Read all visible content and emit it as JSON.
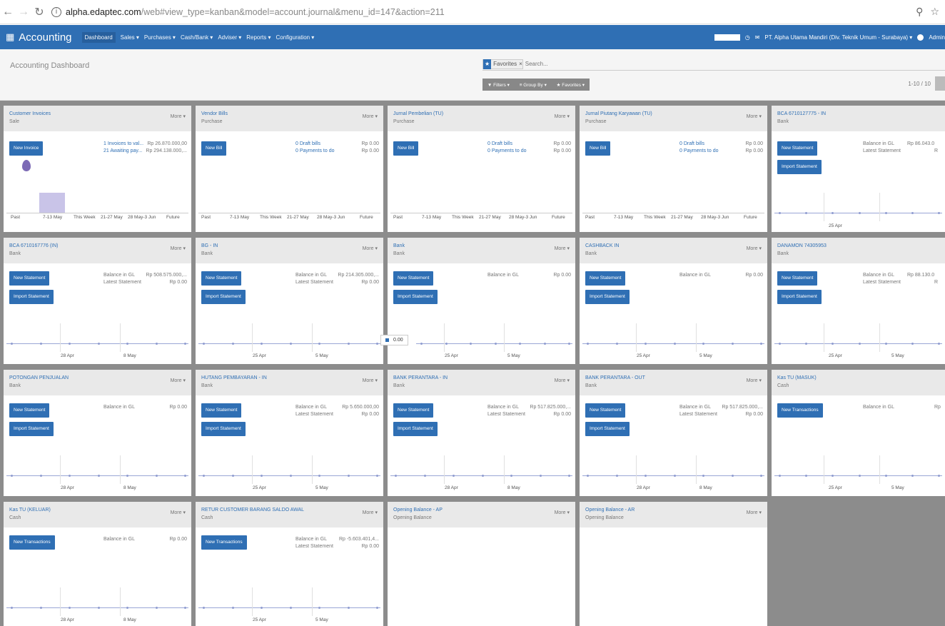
{
  "browser": {
    "url_host": "alpha.edaptec.com",
    "url_path": "/web#view_type=kanban&model=account.journal&menu_id=147&action=211"
  },
  "topnav": {
    "app_title": "Accounting",
    "menus": [
      "Dashboard",
      "Sales ▾",
      "Purchases ▾",
      "Cash/Bank ▾",
      "Adviser ▾",
      "Reports ▾",
      "Configuration ▾"
    ],
    "company": "PT. Alpha Utama Mandiri (Div. Teknik Umum - Surabaya) ▾",
    "user": "Admin"
  },
  "control": {
    "breadcrumb": "Accounting Dashboard",
    "facet": "Favorites",
    "search_placeholder": "Search...",
    "filters": "▼ Filters ▾",
    "groupby": "≡ Group By ▾",
    "favorites": "★ Favorites ▾",
    "pager": "1-10 / 10"
  },
  "common": {
    "more": "More ▾",
    "new_statement": "New Statement",
    "import_statement": "Import Statement",
    "new_transactions": "New Transactions",
    "balance_gl": "Balance in GL",
    "latest_statement": "Latest Statement",
    "draft_bills": "0 Draft bills",
    "payments_to_do": "0 Payments to do",
    "rp_zero": "Rp 0.00",
    "tick_apr": "28 Apr",
    "tick_may": "8 May",
    "tick_apr25": "25 Apr",
    "tick_may5": "5 May",
    "tooltip_value": "0.00",
    "sale_ticks": [
      "Past",
      "7-13 May",
      "This Week",
      "21-27 May",
      "28 May-3 Jun",
      "Future"
    ]
  },
  "cards": {
    "c1": {
      "title": "Customer Invoices",
      "sub": "Sale",
      "btn": "New Invoice",
      "l1": "1 Invoices to val...",
      "r1": "Rp 26.870.000,00",
      "l2": "21 Awaiting pay...",
      "r2": "Rp 294.138.000,..."
    },
    "c2": {
      "title": "Vendor Bills",
      "sub": "Purchase",
      "btn": "New Bill"
    },
    "c3": {
      "title": "Jurnal Pembelian (TU)",
      "sub": "Purchase",
      "btn": "New Bill"
    },
    "c4": {
      "title": "Jurnal Piutang Karyawan (TU)",
      "sub": "Purchase",
      "btn": "New Bill"
    },
    "c5": {
      "title": "BCA 6710127775 - IN",
      "sub": "Bank",
      "r1": "Rp 86.043.0",
      "r2": "R"
    },
    "c6": {
      "title": "BCA 6710167776 (IN)",
      "sub": "Bank",
      "r1": "Rp 508.575.000,...",
      "r2": "Rp 0.00"
    },
    "c7": {
      "title": "BG - IN",
      "sub": "Bank",
      "r1": "Rp 214.305.000,...",
      "r2": "Rp 0.00"
    },
    "c8": {
      "title": "Bank",
      "sub": "Bank",
      "r1": "Rp 0.00"
    },
    "c9": {
      "title": "CASHBACK IN",
      "sub": "Bank",
      "r1": "Rp 0.00"
    },
    "c10": {
      "title": "DANAMON 74305953",
      "sub": "Bank",
      "r1": "Rp 88.130.0",
      "r2": "R"
    },
    "c11": {
      "title": "POTONGAN PENJUALAN",
      "sub": "Bank",
      "r1": "Rp 0.00"
    },
    "c12": {
      "title": "HUTANG PEMBAYARAN - IN",
      "sub": "Bank",
      "r1": "Rp 5.650.000,00",
      "r2": "Rp 0.00"
    },
    "c13": {
      "title": "BANK PERANTARA - IN",
      "sub": "Bank",
      "r1": "Rp 517.825.000,...",
      "r2": "Rp 0.00"
    },
    "c14": {
      "title": "BANK PERANTARA - OUT",
      "sub": "Bank",
      "r1": "Rp 517.825.000,...",
      "r2": "Rp 0.00"
    },
    "c15": {
      "title": "Kas TU (MASUK)",
      "sub": "Cash",
      "r1": "Rp"
    },
    "c16": {
      "title": "Kas TU (KELUAR)",
      "sub": "Cash",
      "r1": "Rp 0.00"
    },
    "c17": {
      "title": "RETUR CUSTOMER BARANG SALDO AWAL",
      "sub": "Cash",
      "r1": "Rp -5.603.401,4...",
      "r2": "Rp 0.00"
    },
    "c18": {
      "title": "Opening Balance - AP",
      "sub": "Opening Balance"
    },
    "c19": {
      "title": "Opening Balance - AR",
      "sub": "Opening Balance"
    }
  },
  "colors": {
    "brand": "#2f6fb4",
    "kanban_bg": "#8c8c8c"
  }
}
